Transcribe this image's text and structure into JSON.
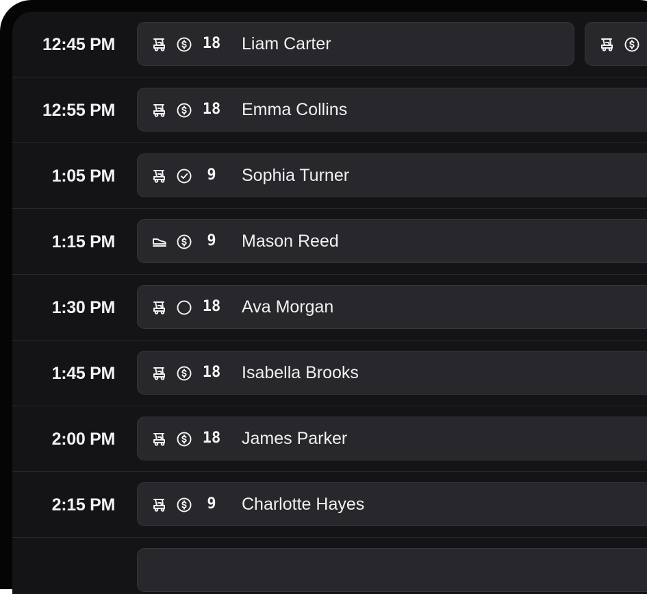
{
  "tee_sheet": {
    "rows": [
      {
        "time": "12:45 PM",
        "transport": "cart-icon",
        "payment": "paid-icon",
        "holes": "18",
        "name": "Liam Carter",
        "extra": {
          "transport": "cart-icon",
          "payment": "paid-icon"
        }
      },
      {
        "time": "12:55 PM",
        "transport": "cart-icon",
        "payment": "paid-icon",
        "holes": "18",
        "name": "Emma Collins"
      },
      {
        "time": "1:05 PM",
        "transport": "cart-icon",
        "payment": "checked-in-icon",
        "holes": "9",
        "name": "Sophia Turner"
      },
      {
        "time": "1:15 PM",
        "transport": "walking-shoe-icon",
        "payment": "paid-icon",
        "holes": "9",
        "name": "Mason Reed"
      },
      {
        "time": "1:30 PM",
        "transport": "cart-icon",
        "payment": "unpaid-icon",
        "holes": "18",
        "name": "Ava Morgan"
      },
      {
        "time": "1:45 PM",
        "transport": "cart-icon",
        "payment": "paid-icon",
        "holes": "18",
        "name": "Isabella Brooks"
      },
      {
        "time": "2:00 PM",
        "transport": "cart-icon",
        "payment": "paid-icon",
        "holes": "18",
        "name": "James Parker"
      },
      {
        "time": "2:15 PM",
        "transport": "cart-icon",
        "payment": "paid-icon",
        "holes": "9",
        "name": "Charlotte Hayes"
      },
      {
        "time": "",
        "transport": "",
        "payment": "",
        "holes": "",
        "name": ""
      }
    ]
  },
  "colors": {
    "background": "#141416",
    "card": "#28282c",
    "text": "#f2f2f4"
  }
}
